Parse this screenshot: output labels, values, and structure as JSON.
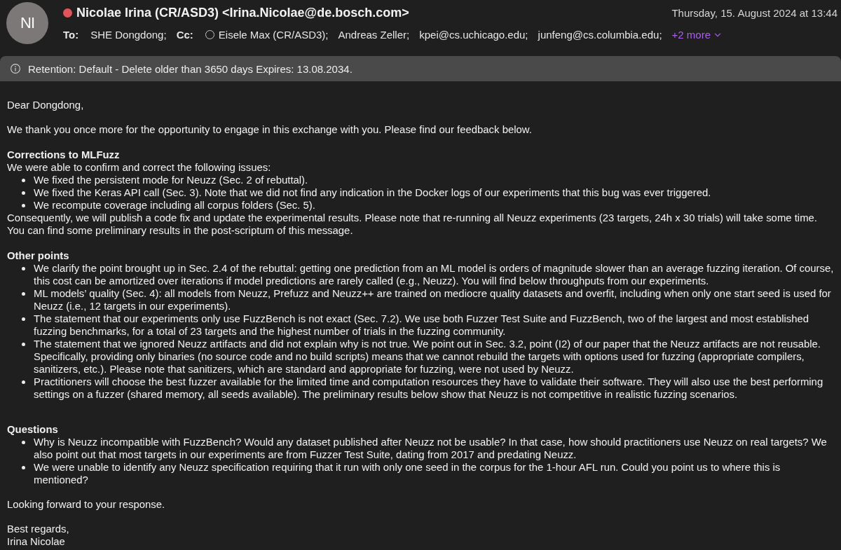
{
  "header": {
    "avatar": {
      "initials": "NI"
    },
    "busy": true,
    "sender": "Nicolae Irina (CR/ASD3) <Irina.Nicolae@de.bosch.com>",
    "date": "Thursday, 15. August 2024 at 13:44",
    "to": {
      "label": "To:",
      "recipients": [
        {
          "name": "SHE Dongdong;",
          "presence_unknown": false
        }
      ]
    },
    "cc": {
      "label": "Cc:",
      "recipients": [
        {
          "name": "Eisele Max (CR/ASD3);",
          "presence_unknown": true
        },
        {
          "name": "Andreas Zeller;",
          "presence_unknown": false
        },
        {
          "name": "kpei@cs.uchicago.edu;",
          "presence_unknown": false
        },
        {
          "name": "junfeng@cs.columbia.edu;",
          "presence_unknown": false
        }
      ]
    },
    "more_link": "+2 more"
  },
  "retention": {
    "text": "Retention: Default - Delete older than 3650 days Expires: 13.08.2034."
  },
  "body": {
    "greeting": "Dear Dongdong,",
    "intro": "We thank you once more for the opportunity to engage in this exchange with you. Please find our feedback below.",
    "sections": [
      {
        "heading": "Corrections to MLFuzz",
        "lead": "We were able to confirm and correct the following issues:",
        "items": [
          "We fixed the persistent mode for Neuzz (Sec. 2 of rebuttal).",
          "We fixed the Keras API call (Sec. 3). Note that we did not find any indication in the Docker logs of our experiments that this bug was ever triggered.",
          "We recompute coverage including all corpus folders (Sec. 5)."
        ],
        "after": "Consequently, we will publish a code fix and update the experimental results. Please note that re-running all Neuzz experiments (23 targets, 24h x 30 trials) will take some time. You can find some preliminary results in the post-scriptum of this message."
      },
      {
        "heading": "Other points",
        "items": [
          "We clarify the point brought up in Sec. 2.4 of the rebuttal: getting one prediction from an ML model is orders of magnitude slower than an average fuzzing iteration. Of course, this cost can be amortized over iterations if model predictions are rarely called (e.g., Neuzz). You will find below throughputs from our experiments.",
          "ML models’ quality (Sec. 4): all models from Neuzz, Prefuzz and Neuzz++ are trained on mediocre quality datasets and overfit, including when only one start seed is used for Neuzz (i.e., 12 targets in our experiments).",
          "The statement that our experiments only use FuzzBench is not exact (Sec. 7.2). We use both Fuzzer Test Suite and FuzzBench, two of the largest and most established fuzzing benchmarks, for a total of 23 targets and the highest number of trials in the fuzzing community.",
          "The statement that we ignored Neuzz artifacts and did not explain why is not true. We point out in Sec. 3.2, point (I2) of our paper that the Neuzz artifacts are not reusable. Specifically, providing only binaries (no source code and no build scripts) means that we cannot rebuild the targets with options used for fuzzing (appropriate compilers, sanitizers, etc.). Please note that sanitizers, which are standard and appropriate for fuzzing, were not used by Neuzz.",
          "Practitioners will choose the best fuzzer available for the limited time and computation resources they have to validate their software. They will also use the best performing settings on a fuzzer (shared memory, all seeds available). The preliminary results below show that Neuzz is not competitive in realistic fuzzing scenarios."
        ]
      },
      {
        "heading": "Questions",
        "items": [
          "Why is Neuzz incompatible with FuzzBench? Would any dataset published after Neuzz not be usable? In that case, how should practitioners use Neuzz on real targets? We also point out that most targets in our experiments are from Fuzzer Test Suite, dating from 2017 and predating Neuzz.",
          "We were unable to identify any Neuzz specification requiring that it run with only one seed in the corpus for the 1-hour AFL run. Could you point us to where this is mentioned?"
        ]
      }
    ],
    "closing": "Looking forward to your response.",
    "signoff": "Best regards,",
    "signature": "Irina Nicolae"
  }
}
